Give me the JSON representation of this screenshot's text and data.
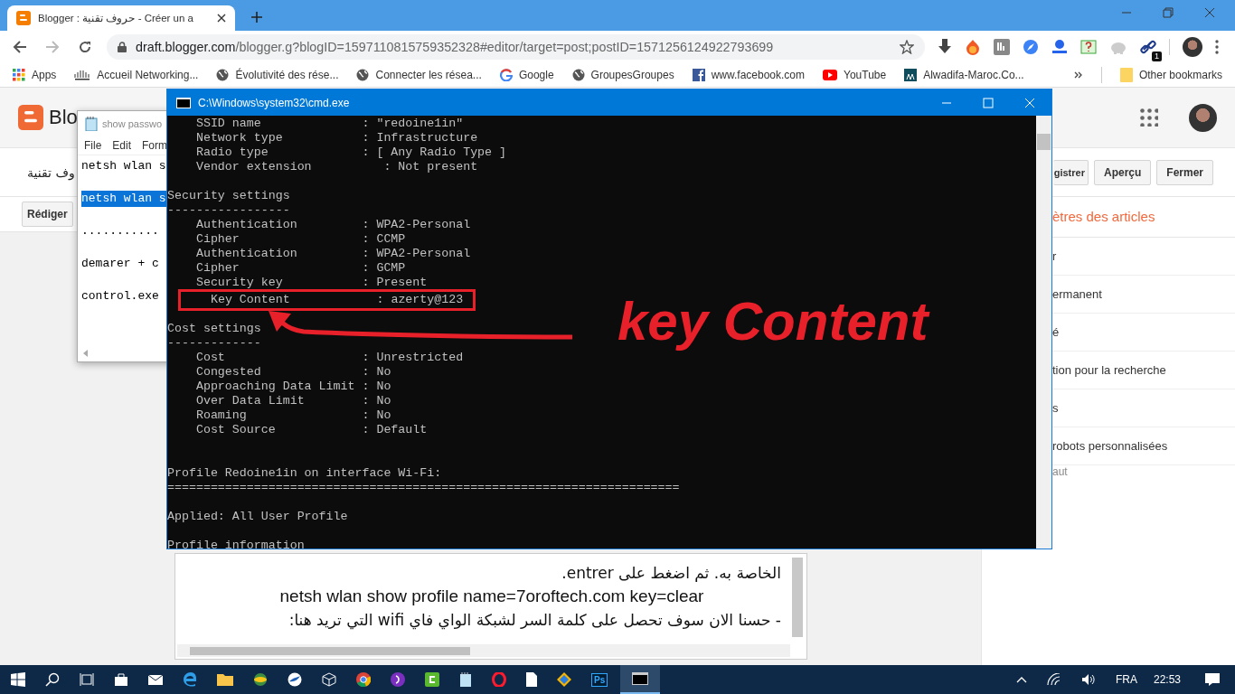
{
  "browser": {
    "tab_title": "Blogger : حروف تقنية - Créer un a",
    "url_host": "draft.blogger.com",
    "url_path": "/blogger.g?blogID=1597110815759352328#editor/target=post;postID=1571256124922793699",
    "extension_badge": "1",
    "bookmarks": [
      {
        "label": "Apps",
        "kind": "apps"
      },
      {
        "label": "Accueil Networking...",
        "kind": "cisco"
      },
      {
        "label": "Évolutivité des rése...",
        "kind": "globe"
      },
      {
        "label": "Connecter les réseа...",
        "kind": "globe"
      },
      {
        "label": "Google",
        "kind": "google"
      },
      {
        "label": "GroupesGroupes",
        "kind": "globe"
      },
      {
        "label": "www.facebook.com",
        "kind": "facebook"
      },
      {
        "label": "YouTube",
        "kind": "youtube"
      },
      {
        "label": "Alwadifa-Maroc.Co...",
        "kind": "people"
      }
    ],
    "other_bookmarks": "Other bookmarks"
  },
  "blogger": {
    "logo_text": "Blo",
    "post_title": "وف تقنية",
    "buttons": [
      "gistrer",
      "Aperçu",
      "Fermer"
    ],
    "compose_button": "Rédiger",
    "settings_title": "ètres des articles",
    "settings_items": [
      "r",
      "ermanent",
      "é",
      "tion pour la recherche",
      "s",
      "robots personnalisées"
    ],
    "settings_subtext": "aut",
    "editor_lines": [
      {
        "text": "الخاصة به. ثم اضغط على entrer.",
        "kind": "rtl"
      },
      {
        "text": "netsh wlan show profile name=7oroftech.com key=clear",
        "kind": "ltr"
      },
      {
        "text": "- حسنا الان سوف تحصل على كلمة السر لشبكة الواي فاي wifi التي تريد هنا:",
        "kind": "rtl"
      }
    ]
  },
  "notepad": {
    "title": "show passwo",
    "menu": [
      "File",
      "Edit",
      "Form"
    ],
    "lines": [
      {
        "text": "netsh wlan s",
        "selected": false
      },
      {
        "text": "netsh wlan s",
        "selected": true
      },
      {
        "text": "...........",
        "selected": false
      },
      {
        "text": "demarer + c",
        "selected": false
      },
      {
        "text": "control.exe",
        "selected": false
      }
    ]
  },
  "cmd": {
    "title": "C:\\Windows\\system32\\cmd.exe",
    "blocks": [
      [
        {
          "text": "    SSID name              : \"redoine1in\"",
          "highlighted": false
        },
        {
          "text": "    Network type           : Infrastructure",
          "highlighted": false
        },
        {
          "text": "    Radio type             : [ Any Radio Type ]",
          "highlighted": false
        },
        {
          "text": "    Vendor extension          : Not present",
          "highlighted": false
        }
      ],
      [
        {
          "text": "Security settings",
          "highlighted": false
        },
        {
          "text": "-----------------",
          "highlighted": false
        },
        {
          "text": "    Authentication         : WPA2-Personal",
          "highlighted": false
        },
        {
          "text": "    Cipher                 : CCMP",
          "highlighted": false
        },
        {
          "text": "    Authentication         : WPA2-Personal",
          "highlighted": false
        },
        {
          "text": "    Cipher                 : GCMP",
          "highlighted": false
        },
        {
          "text": "    Security key           : Present",
          "highlighted": false
        },
        {
          "text": "    Key Content            : azerty@123",
          "highlighted": true
        }
      ],
      [
        {
          "text": "Cost settings",
          "highlighted": false
        },
        {
          "text": "-------------",
          "highlighted": false
        },
        {
          "text": "    Cost                   : Unrestricted",
          "highlighted": false
        },
        {
          "text": "    Congested              : No",
          "highlighted": false
        },
        {
          "text": "    Approaching Data Limit : No",
          "highlighted": false
        },
        {
          "text": "    Over Data Limit        : No",
          "highlighted": false
        },
        {
          "text": "    Roaming                : No",
          "highlighted": false
        },
        {
          "text": "    Cost Source            : Default",
          "highlighted": false
        }
      ],
      [
        {
          "text": "Profile Redoine1in on interface Wi-Fi:",
          "highlighted": false
        },
        {
          "text": "=======================================================================",
          "highlighted": false
        }
      ],
      [
        {
          "text": "Applied: All User Profile",
          "highlighted": false
        }
      ],
      [
        {
          "text": "Profile information",
          "highlighted": false
        }
      ]
    ]
  },
  "annotation": {
    "text": "key Content"
  },
  "taskbar": {
    "photoshop_label": "Ps",
    "language": "FRA",
    "time": "22:53"
  }
}
